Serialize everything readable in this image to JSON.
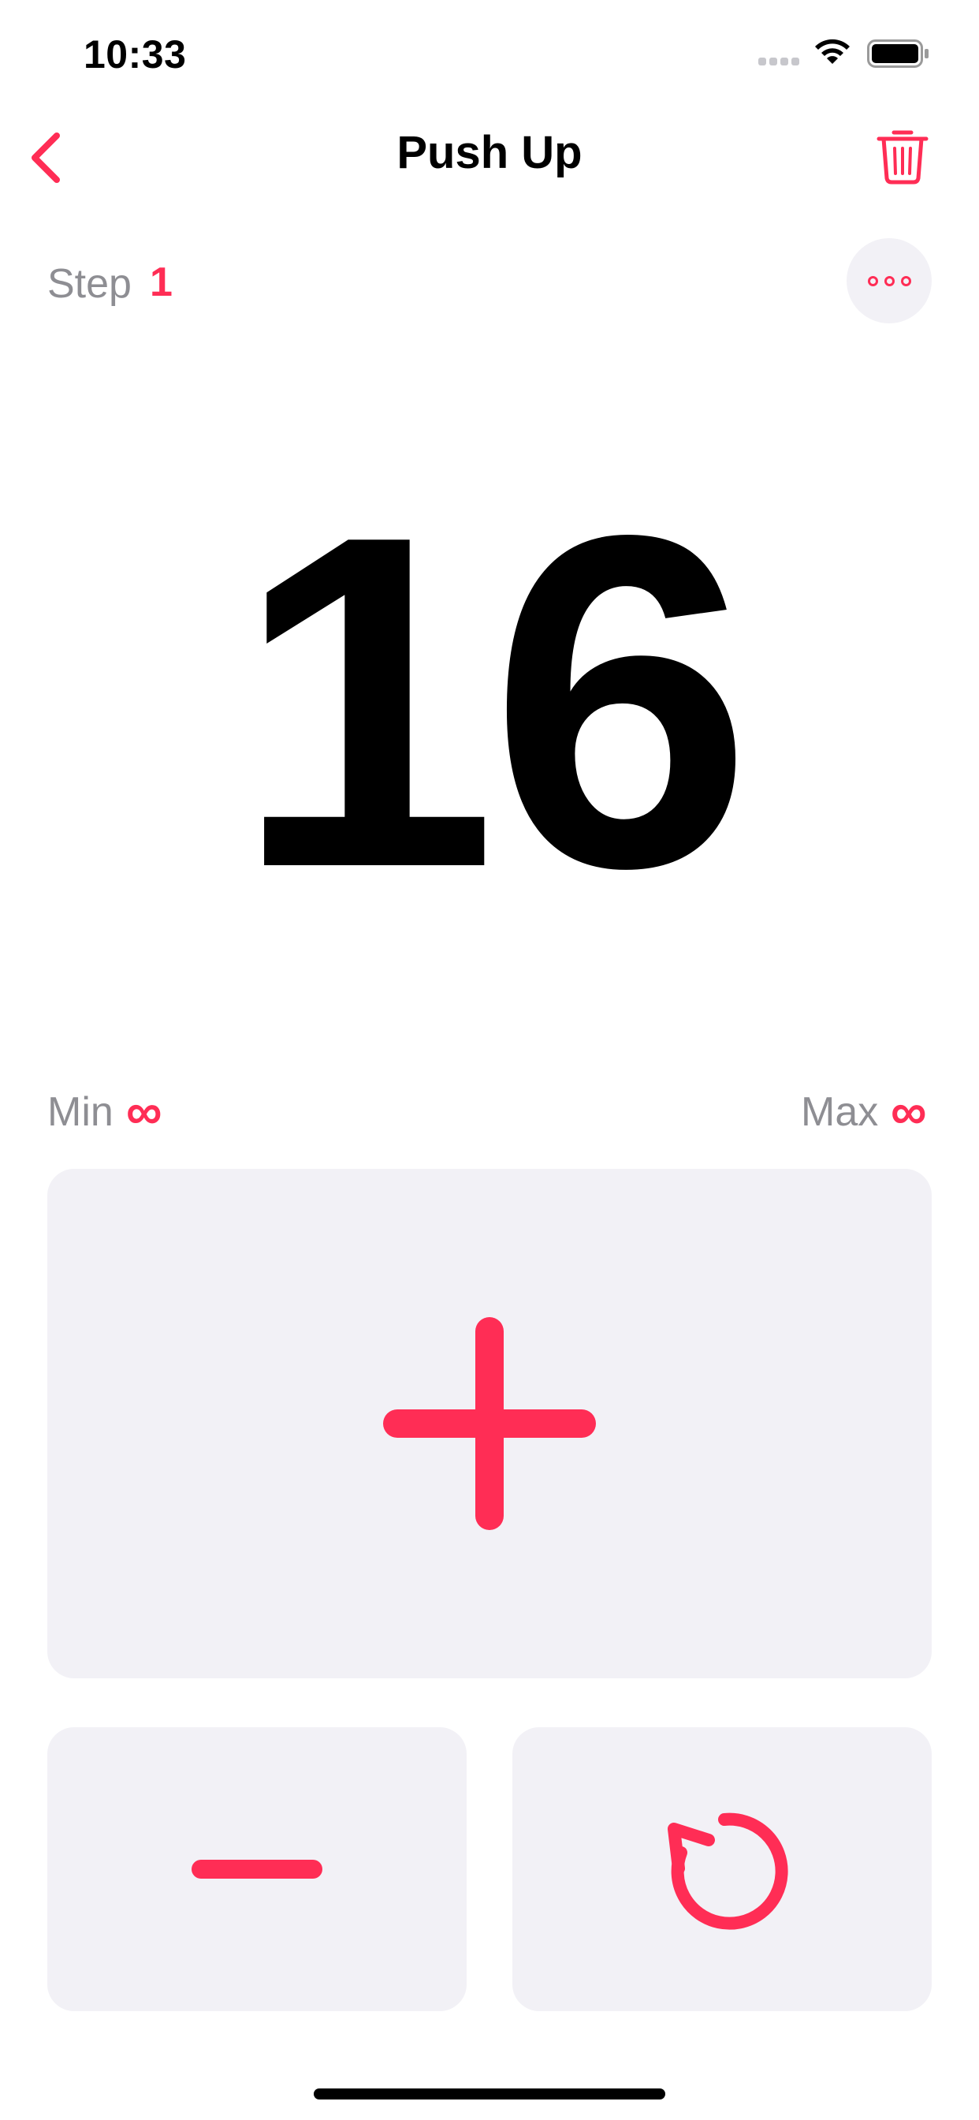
{
  "status_bar": {
    "time": "10:33"
  },
  "nav": {
    "title": "Push Up",
    "back_icon": "chevron-left-icon",
    "trash_icon": "trash-icon"
  },
  "step": {
    "label": "Step",
    "value": "1"
  },
  "more_icon": "ellipsis-icon",
  "counter": {
    "value": "16"
  },
  "limits": {
    "min_label": "Min",
    "min_value": "∞",
    "max_label": "Max",
    "max_value": "∞"
  },
  "controls": {
    "increment_icon": "plus-icon",
    "decrement_icon": "minus-icon",
    "reset_icon": "reset-icon"
  },
  "colors": {
    "accent": "#ff2d55",
    "secondary_text": "#8e8e93",
    "pad_background": "#f2f1f6"
  }
}
